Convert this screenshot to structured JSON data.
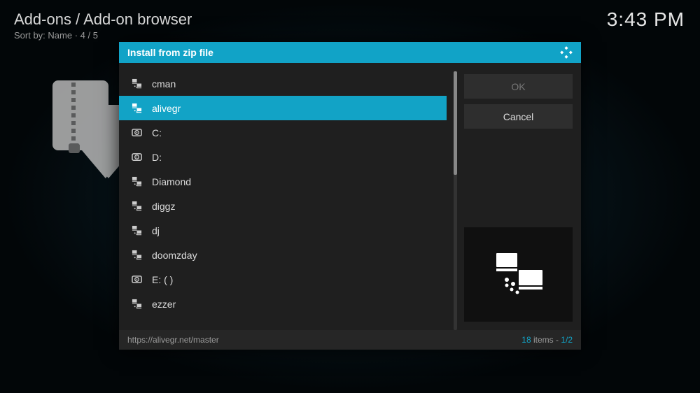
{
  "header": {
    "breadcrumb": "Add-ons / Add-on browser",
    "sort_label": "Sort by: Name  ·  4 / 5"
  },
  "clock": "3:43 PM",
  "dialog": {
    "title": "Install from zip file",
    "buttons": {
      "ok": "OK",
      "cancel": "Cancel"
    },
    "footer": {
      "path": "https://alivegr.net/master",
      "count": "18",
      "items_word": " items - ",
      "page": "1/2"
    }
  },
  "files": [
    {
      "label": "cman",
      "icon": "network",
      "selected": false
    },
    {
      "label": "alivegr",
      "icon": "network",
      "selected": true
    },
    {
      "label": "C:",
      "icon": "drive",
      "selected": false
    },
    {
      "label": "D:",
      "icon": "drive",
      "selected": false
    },
    {
      "label": "Diamond",
      "icon": "network",
      "selected": false
    },
    {
      "label": "diggz",
      "icon": "network",
      "selected": false
    },
    {
      "label": "dj",
      "icon": "network",
      "selected": false
    },
    {
      "label": "doomzday",
      "icon": "network",
      "selected": false
    },
    {
      "label": "E: ( )",
      "icon": "drive",
      "selected": false
    },
    {
      "label": "ezzer",
      "icon": "network",
      "selected": false
    }
  ]
}
